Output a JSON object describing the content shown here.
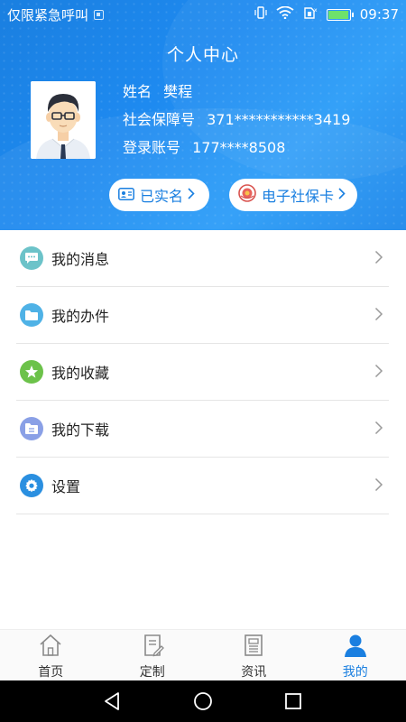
{
  "status_bar": {
    "carrier_text": "仅限紧急呼叫",
    "time": "09:37"
  },
  "header": {
    "title": "个人中心"
  },
  "profile": {
    "name_label": "姓名",
    "name_value": "樊程",
    "ssn_label": "社会保障号",
    "ssn_value": "371***********3419",
    "account_label": "登录账号",
    "account_value": "177****8508"
  },
  "badges": {
    "realname_label": "已实名",
    "card_label": "电子社保卡"
  },
  "menu": {
    "items": [
      {
        "label": "我的消息",
        "icon": "message-icon",
        "color": "#6cc3c9"
      },
      {
        "label": "我的办件",
        "icon": "folder-icon",
        "color": "#4fb2e6"
      },
      {
        "label": "我的收藏",
        "icon": "star-icon",
        "color": "#6cc24a"
      },
      {
        "label": "我的下载",
        "icon": "download-folder-icon",
        "color": "#8aa0e6"
      },
      {
        "label": "设置",
        "icon": "gear-icon",
        "color": "#2a8fe0"
      }
    ]
  },
  "tabbar": {
    "tabs": [
      {
        "label": "首页",
        "icon": "home-icon"
      },
      {
        "label": "定制",
        "icon": "customize-icon"
      },
      {
        "label": "资讯",
        "icon": "news-icon"
      },
      {
        "label": "我的",
        "icon": "profile-icon"
      }
    ],
    "active_index": 3
  },
  "colors": {
    "accent": "#1a7fe0",
    "header_gradient_start": "#1a7fe0",
    "header_gradient_end": "#2a9cf8"
  }
}
